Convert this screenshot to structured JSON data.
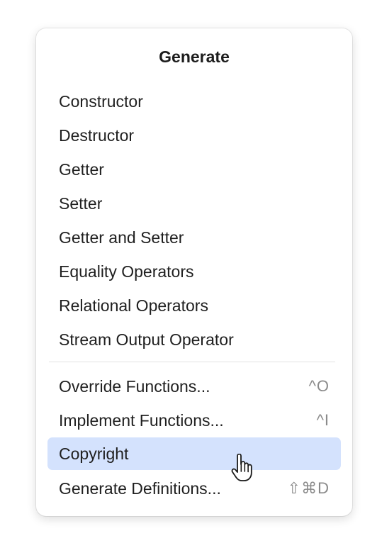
{
  "menu": {
    "title": "Generate",
    "groups": [
      {
        "items": [
          {
            "label": "Constructor"
          },
          {
            "label": "Destructor"
          },
          {
            "label": "Getter"
          },
          {
            "label": "Setter"
          },
          {
            "label": "Getter and Setter"
          },
          {
            "label": "Equality Operators"
          },
          {
            "label": "Relational Operators"
          },
          {
            "label": "Stream Output Operator"
          }
        ]
      },
      {
        "items": [
          {
            "label": "Override Functions...",
            "shortcut": "^O"
          },
          {
            "label": "Implement Functions...",
            "shortcut": "^I"
          },
          {
            "label": "Copyright",
            "selected": true
          },
          {
            "label": "Generate Definitions...",
            "shortcut": "⇧⌘D"
          }
        ]
      }
    ]
  },
  "colors": {
    "selection": "#d4e2fd",
    "shortcut_text": "#8a8a8a"
  },
  "cursor": {
    "icon": "hand-pointer-icon"
  }
}
